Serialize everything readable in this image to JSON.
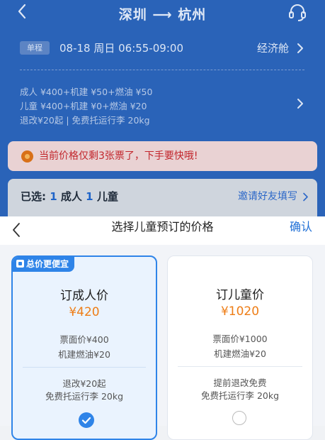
{
  "header": {
    "title": "深圳 ⟶ 杭州",
    "back_icon": "back-arrow-icon",
    "service_icon": "headset-icon"
  },
  "trip": {
    "badge": "单程",
    "datetime": "08-18 周日 06:55-09:00",
    "cabin": "经济舱"
  },
  "fares": {
    "adult": "成人 ¥400+机建 ¥50+燃油 ¥50",
    "child": "儿童 ¥400+机建 ¥0+燃油 ¥20",
    "policy": "退改¥20起 | 免费托运行李 20kg"
  },
  "notice": {
    "text": "当前价格仅剩3张票了，下手要快哦!",
    "icon": "coin-icon"
  },
  "selection": {
    "prefix": "已选:",
    "adult_count": "1",
    "adult_label": "成人",
    "child_count": "1",
    "child_label": "儿童",
    "invite": "邀请好友填写"
  },
  "sheet": {
    "title": "选择儿童预订的价格",
    "confirm": "确认",
    "options": [
      {
        "tag": "总价更便宜",
        "name": "订成人价",
        "price": "¥420",
        "line1": "票面价¥400",
        "line2": "机建燃油¥20",
        "line3": "退改¥20起",
        "line4": "免费托运行李 20kg",
        "selected": true
      },
      {
        "name": "订儿童价",
        "price": "¥1020",
        "line1": "票面价¥1000",
        "line2": "机建燃油¥20",
        "line3": "提前退改免费",
        "line4": "免费托运行李 20kg",
        "selected": false
      }
    ]
  },
  "colors": {
    "header_bg": "#2a63b8",
    "accent": "#2f84e8",
    "price": "#ee7d16",
    "warning": "#c2262c"
  }
}
